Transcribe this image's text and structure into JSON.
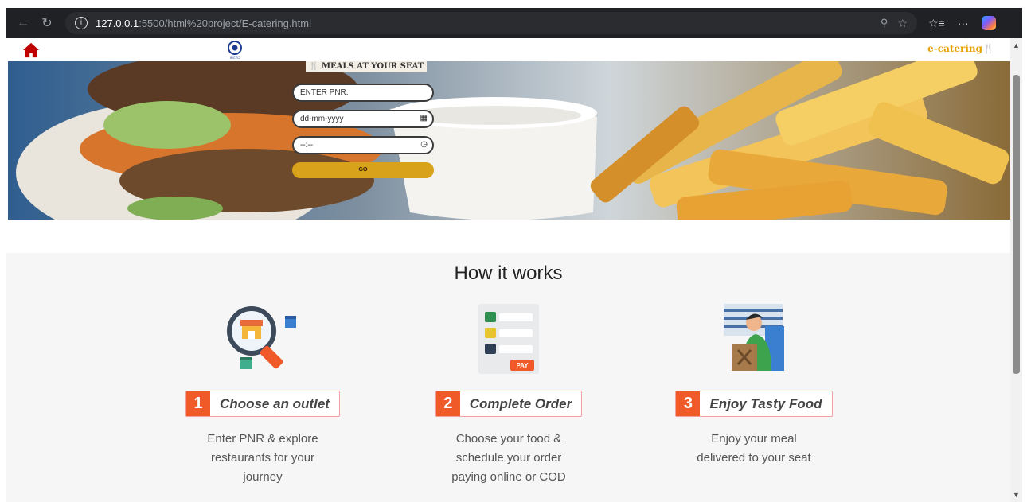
{
  "browser": {
    "url_host": "127.0.0.1",
    "url_path": ":5500/html%20project/E-catering.html"
  },
  "page": {
    "brand": "e-catering",
    "logo_text": "IRCTC",
    "hero_title": "MEALS AT YOUR SEAT",
    "form": {
      "pnr_placeholder": "ENTER PNR.",
      "date_placeholder": "dd-mm-yyyy",
      "time_placeholder": "--:--",
      "submit_label": "GO"
    }
  },
  "how_it_works": {
    "title": "How it works",
    "steps": [
      {
        "num": "1",
        "label": "Choose an outlet",
        "desc_line1": "Enter PNR & explore",
        "desc_line2": "restaurants for your",
        "desc_line3": "journey"
      },
      {
        "num": "2",
        "label": "Complete Order",
        "desc_line1": "Choose your food &",
        "desc_line2": "schedule your order",
        "desc_line3": "paying online or COD"
      },
      {
        "num": "3",
        "label": "Enjoy Tasty Food",
        "desc_line1": "Enjoy your meal",
        "desc_line2": "delivered to your seat",
        "desc_line3": ""
      }
    ],
    "pay_badge": "PAY"
  },
  "colors": {
    "accent_orange": "#f05a28",
    "brand_gold": "#e6a100",
    "go_button": "#d9a21b",
    "home_icon": "#c00000"
  },
  "icons": [
    "back-icon",
    "refresh-icon",
    "info-icon",
    "zoom-icon",
    "star-icon",
    "favorites-icon",
    "more-icon",
    "copilot-icon",
    "home-icon",
    "calendar-icon",
    "clock-icon"
  ]
}
